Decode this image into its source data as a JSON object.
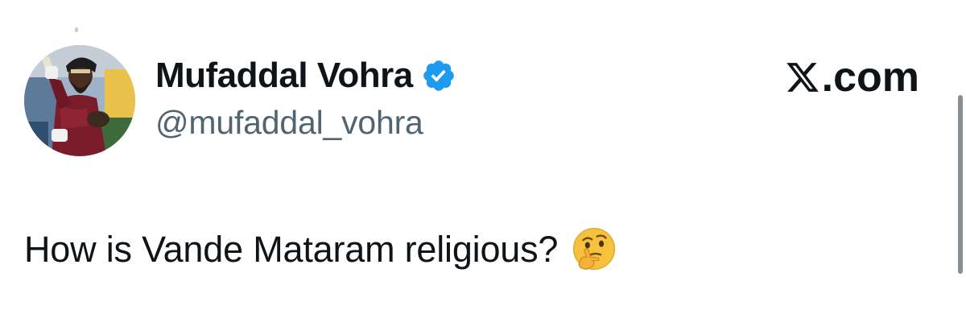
{
  "tweet": {
    "author": {
      "display_name": "Mufaddal Vohra",
      "handle": "@mufaddal_vohra",
      "verified": true,
      "avatar": "avatar-photo"
    },
    "brand": {
      "text": ".com",
      "icon": "x-logo-icon"
    },
    "text": "How is Vande Mataram religious?",
    "emoji": "thinking-face-icon"
  },
  "colors": {
    "text_primary": "#0f1419",
    "text_secondary": "#536471",
    "verified_blue": "#1d9bf0",
    "background": "#ffffff"
  }
}
